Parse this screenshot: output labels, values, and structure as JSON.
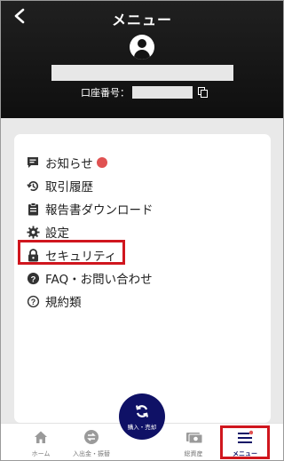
{
  "header": {
    "title": "メニュー",
    "account_label": "口座番号："
  },
  "menu": {
    "items": [
      {
        "label": "お知らせ",
        "icon": "message-icon",
        "has_badge": true
      },
      {
        "label": "取引履歴",
        "icon": "history-icon"
      },
      {
        "label": "報告書ダウンロード",
        "icon": "clipboard-icon"
      },
      {
        "label": "設定",
        "icon": "gear-icon"
      },
      {
        "label": "セキュリティ",
        "icon": "lock-icon"
      },
      {
        "label": "FAQ・お問い合わせ",
        "icon": "question-circle-icon"
      },
      {
        "label": "規約類",
        "icon": "question-outline-icon"
      }
    ]
  },
  "bottom_nav": {
    "home": "ホーム",
    "deposit": "入出金・振替",
    "trade": "購入・売却",
    "assets": "総資産",
    "menu": "メニュー"
  },
  "colors": {
    "header_bg": "#141414",
    "accent_navy": "#0f1166",
    "badge_red": "#e05252",
    "highlight_red": "#d0161e"
  }
}
